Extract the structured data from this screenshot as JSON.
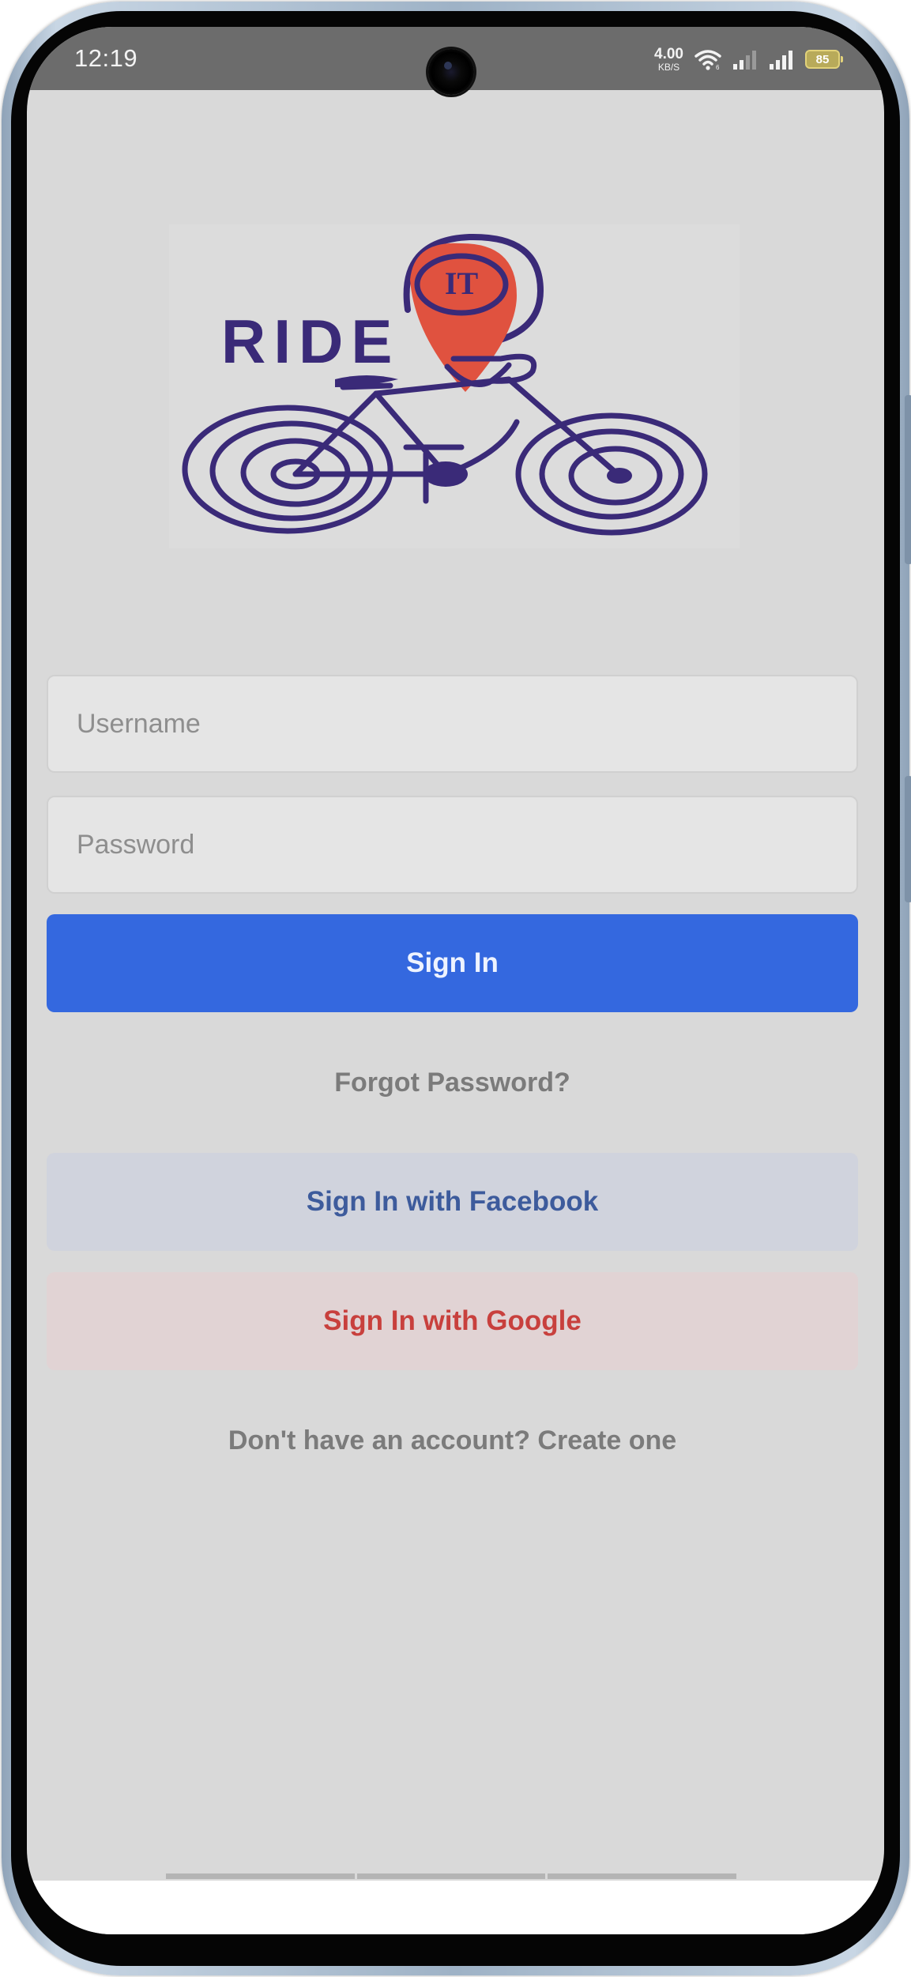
{
  "status_bar": {
    "time": "12:19",
    "net_speed_value": "4.00",
    "net_speed_unit": "KB/S",
    "battery_level": "85",
    "icons": [
      "wifi-icon",
      "signal-weak-icon",
      "signal-strong-icon",
      "battery-icon"
    ]
  },
  "logo": {
    "brand_text": "RIDE",
    "pin_text": "IT",
    "ink_color": "#3a2a78",
    "pin_color": "#e0523f"
  },
  "login_form": {
    "username_placeholder": "Username",
    "password_placeholder": "Password",
    "sign_in_label": "Sign In",
    "forgot_password_label": "Forgot Password?",
    "facebook_label": "Sign In with Facebook",
    "google_label": "Sign In with Google",
    "create_account_label": "Don't have an account? Create one"
  },
  "colors": {
    "background": "#d9d9d9",
    "primary_button": "#3468df",
    "facebook_text": "#3d5b9c",
    "google_text": "#c8403d"
  }
}
